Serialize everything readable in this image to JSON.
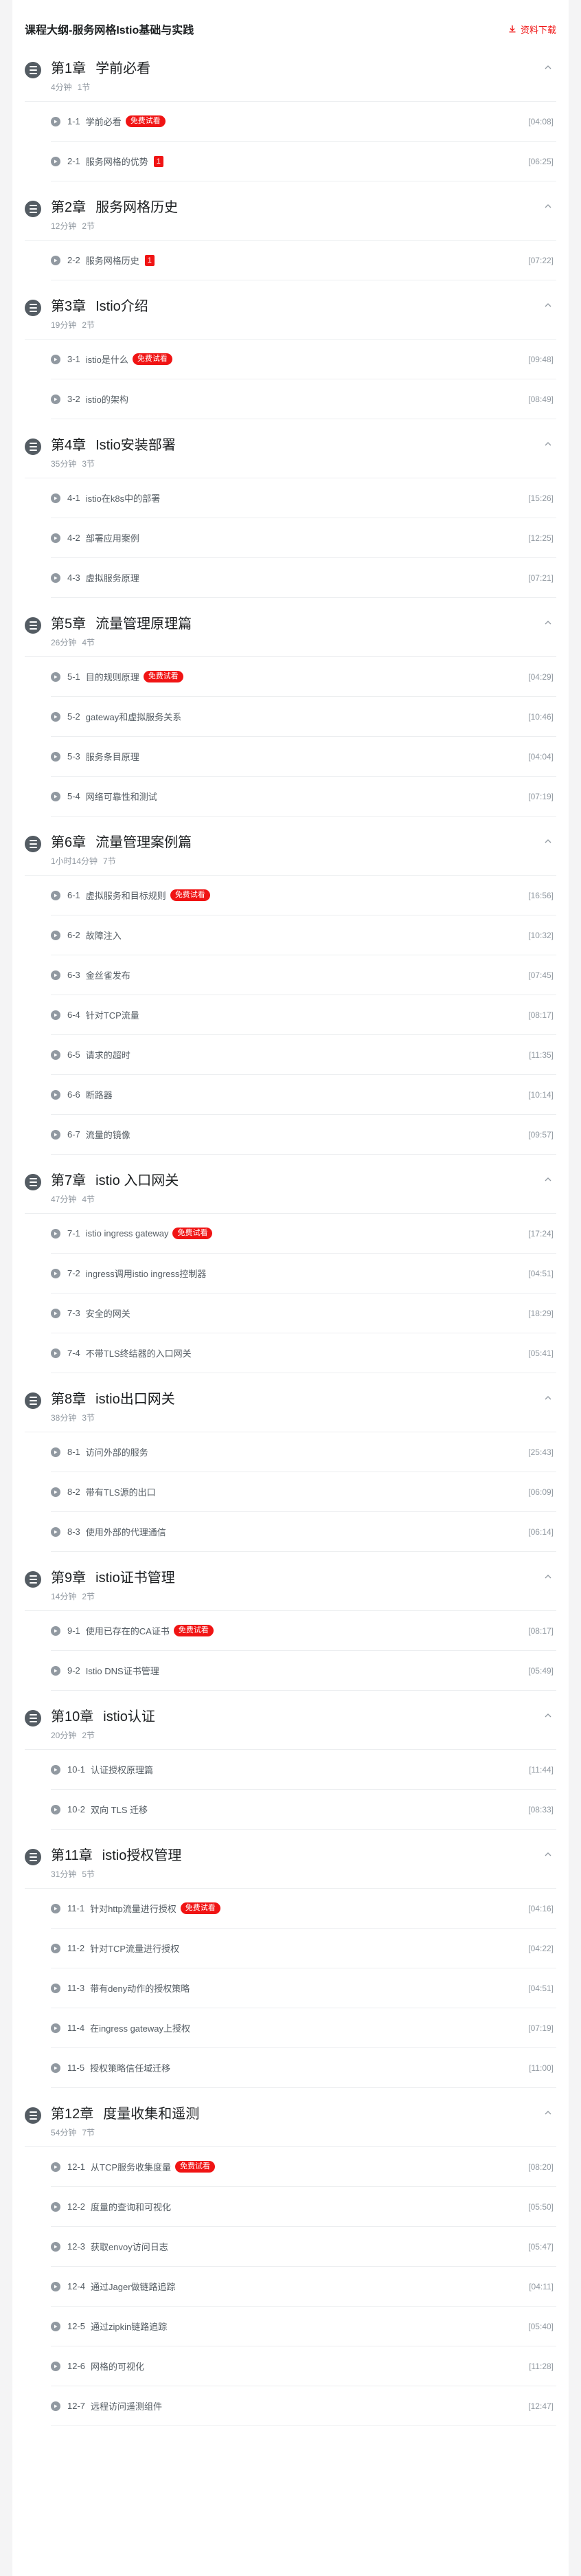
{
  "header": {
    "title": "课程大纲-服务网格Istio基础与实践",
    "download_label": "资料下载"
  },
  "chapters": [
    {
      "num": "第1章",
      "title": "学前必看",
      "duration": "4分钟",
      "count": "1节",
      "lessons": [
        {
          "num": "1-1",
          "title": "学前必看",
          "badge": "免费试看",
          "time": "[04:08]"
        },
        {
          "num": "2-1",
          "title": "服务网格的优势",
          "badge": "",
          "mark": "1",
          "time": "[06:25]"
        }
      ]
    },
    {
      "num": "第2章",
      "title": "服务网格历史",
      "duration": "12分钟",
      "count": "2节",
      "lessons": [
        {
          "num": "2-2",
          "title": "服务网格历史",
          "badge": "",
          "mark": "1",
          "time": "[07:22]"
        }
      ]
    },
    {
      "num": "第3章",
      "title": "Istio介绍",
      "duration": "19分钟",
      "count": "2节",
      "lessons": [
        {
          "num": "3-1",
          "title": "istio是什么",
          "badge": "免费试看",
          "time": "[09:48]"
        },
        {
          "num": "3-2",
          "title": "istio的架构",
          "badge": "",
          "time": "[08:49]"
        }
      ]
    },
    {
      "num": "第4章",
      "title": "Istio安装部署",
      "duration": "35分钟",
      "count": "3节",
      "lessons": [
        {
          "num": "4-1",
          "title": "istio在k8s中的部署",
          "badge": "",
          "time": "[15:26]"
        },
        {
          "num": "4-2",
          "title": "部署应用案例",
          "badge": "",
          "time": "[12:25]"
        },
        {
          "num": "4-3",
          "title": "虚拟服务原理",
          "badge": "",
          "time": "[07:21]"
        }
      ]
    },
    {
      "num": "第5章",
      "title": "流量管理原理篇",
      "duration": "26分钟",
      "count": "4节",
      "lessons": [
        {
          "num": "5-1",
          "title": "目的规则原理",
          "badge": "免费试看",
          "time": "[04:29]"
        },
        {
          "num": "5-2",
          "title": "gateway和虚拟服务关系",
          "badge": "",
          "time": "[10:46]"
        },
        {
          "num": "5-3",
          "title": "服务条目原理",
          "badge": "",
          "time": "[04:04]"
        },
        {
          "num": "5-4",
          "title": "网络可靠性和测试",
          "badge": "",
          "time": "[07:19]"
        }
      ]
    },
    {
      "num": "第6章",
      "title": "流量管理案例篇",
      "duration": "1小时14分钟",
      "count": "7节",
      "lessons": [
        {
          "num": "6-1",
          "title": "虚拟服务和目标规则",
          "badge": "免费试看",
          "time": "[16:56]"
        },
        {
          "num": "6-2",
          "title": "故障注入",
          "badge": "",
          "time": "[10:32]"
        },
        {
          "num": "6-3",
          "title": "金丝雀发布",
          "badge": "",
          "time": "[07:45]"
        },
        {
          "num": "6-4",
          "title": "针对TCP流量",
          "badge": "",
          "time": "[08:17]"
        },
        {
          "num": "6-5",
          "title": "请求的超时",
          "badge": "",
          "time": "[11:35]"
        },
        {
          "num": "6-6",
          "title": "断路器",
          "badge": "",
          "time": "[10:14]"
        },
        {
          "num": "6-7",
          "title": "流量的镜像",
          "badge": "",
          "time": "[09:57]"
        }
      ]
    },
    {
      "num": "第7章",
      "title": "istio 入口网关",
      "duration": "47分钟",
      "count": "4节",
      "lessons": [
        {
          "num": "7-1",
          "title": "istio ingress gateway",
          "badge": "免费试看",
          "time": "[17:24]"
        },
        {
          "num": "7-2",
          "title": "ingress调用istio ingress控制器",
          "badge": "",
          "time": "[04:51]"
        },
        {
          "num": "7-3",
          "title": "安全的网关",
          "badge": "",
          "time": "[18:29]"
        },
        {
          "num": "7-4",
          "title": "不带TLS终结器的入口网关",
          "badge": "",
          "time": "[05:41]"
        }
      ]
    },
    {
      "num": "第8章",
      "title": "istio出口网关",
      "duration": "38分钟",
      "count": "3节",
      "lessons": [
        {
          "num": "8-1",
          "title": "访问外部的服务",
          "badge": "",
          "time": "[25:43]"
        },
        {
          "num": "8-2",
          "title": "带有TLS源的出口",
          "badge": "",
          "time": "[06:09]"
        },
        {
          "num": "8-3",
          "title": "使用外部的代理通信",
          "badge": "",
          "time": "[06:14]"
        }
      ]
    },
    {
      "num": "第9章",
      "title": "istio证书管理",
      "duration": "14分钟",
      "count": "2节",
      "lessons": [
        {
          "num": "9-1",
          "title": "使用已存在的CA证书",
          "badge": "免费试看",
          "time": "[08:17]"
        },
        {
          "num": "9-2",
          "title": "Istio DNS证书管理",
          "badge": "",
          "time": "[05:49]"
        }
      ]
    },
    {
      "num": "第10章",
      "title": "istio认证",
      "duration": "20分钟",
      "count": "2节",
      "lessons": [
        {
          "num": "10-1",
          "title": "认证授权原理篇",
          "badge": "",
          "time": "[11:44]"
        },
        {
          "num": "10-2",
          "title": "双向 TLS 迁移",
          "badge": "",
          "time": "[08:33]"
        }
      ]
    },
    {
      "num": "第11章",
      "title": "istio授权管理",
      "duration": "31分钟",
      "count": "5节",
      "lessons": [
        {
          "num": "11-1",
          "title": "针对http流量进行授权",
          "badge": "免费试看",
          "time": "[04:16]"
        },
        {
          "num": "11-2",
          "title": "针对TCP流量进行授权",
          "badge": "",
          "time": "[04:22]"
        },
        {
          "num": "11-3",
          "title": "带有deny动作的授权策略",
          "badge": "",
          "time": "[04:51]"
        },
        {
          "num": "11-4",
          "title": "在ingress gateway上授权",
          "badge": "",
          "time": "[07:19]"
        },
        {
          "num": "11-5",
          "title": "授权策略信任域迁移",
          "badge": "",
          "time": "[11:00]"
        }
      ]
    },
    {
      "num": "第12章",
      "title": "度量收集和遥测",
      "duration": "54分钟",
      "count": "7节",
      "lessons": [
        {
          "num": "12-1",
          "title": "从TCP服务收集度量",
          "badge": "免费试看",
          "time": "[08:20]"
        },
        {
          "num": "12-2",
          "title": "度量的查询和可视化",
          "badge": "",
          "time": "[05:50]"
        },
        {
          "num": "12-3",
          "title": "获取envoy访问日志",
          "badge": "",
          "time": "[05:47]"
        },
        {
          "num": "12-4",
          "title": "通过Jager做链路追踪",
          "badge": "",
          "time": "[04:11]"
        },
        {
          "num": "12-5",
          "title": "通过zipkin链路追踪",
          "badge": "",
          "time": "[05:40]"
        },
        {
          "num": "12-6",
          "title": "网格的可视化",
          "badge": "",
          "time": "[11:28]"
        },
        {
          "num": "12-7",
          "title": "远程访问遥测组件",
          "badge": "",
          "time": "[12:47]"
        }
      ]
    }
  ],
  "colors": {
    "accent": "#f01414",
    "icon": "#545c63",
    "muted": "#9199a1"
  }
}
